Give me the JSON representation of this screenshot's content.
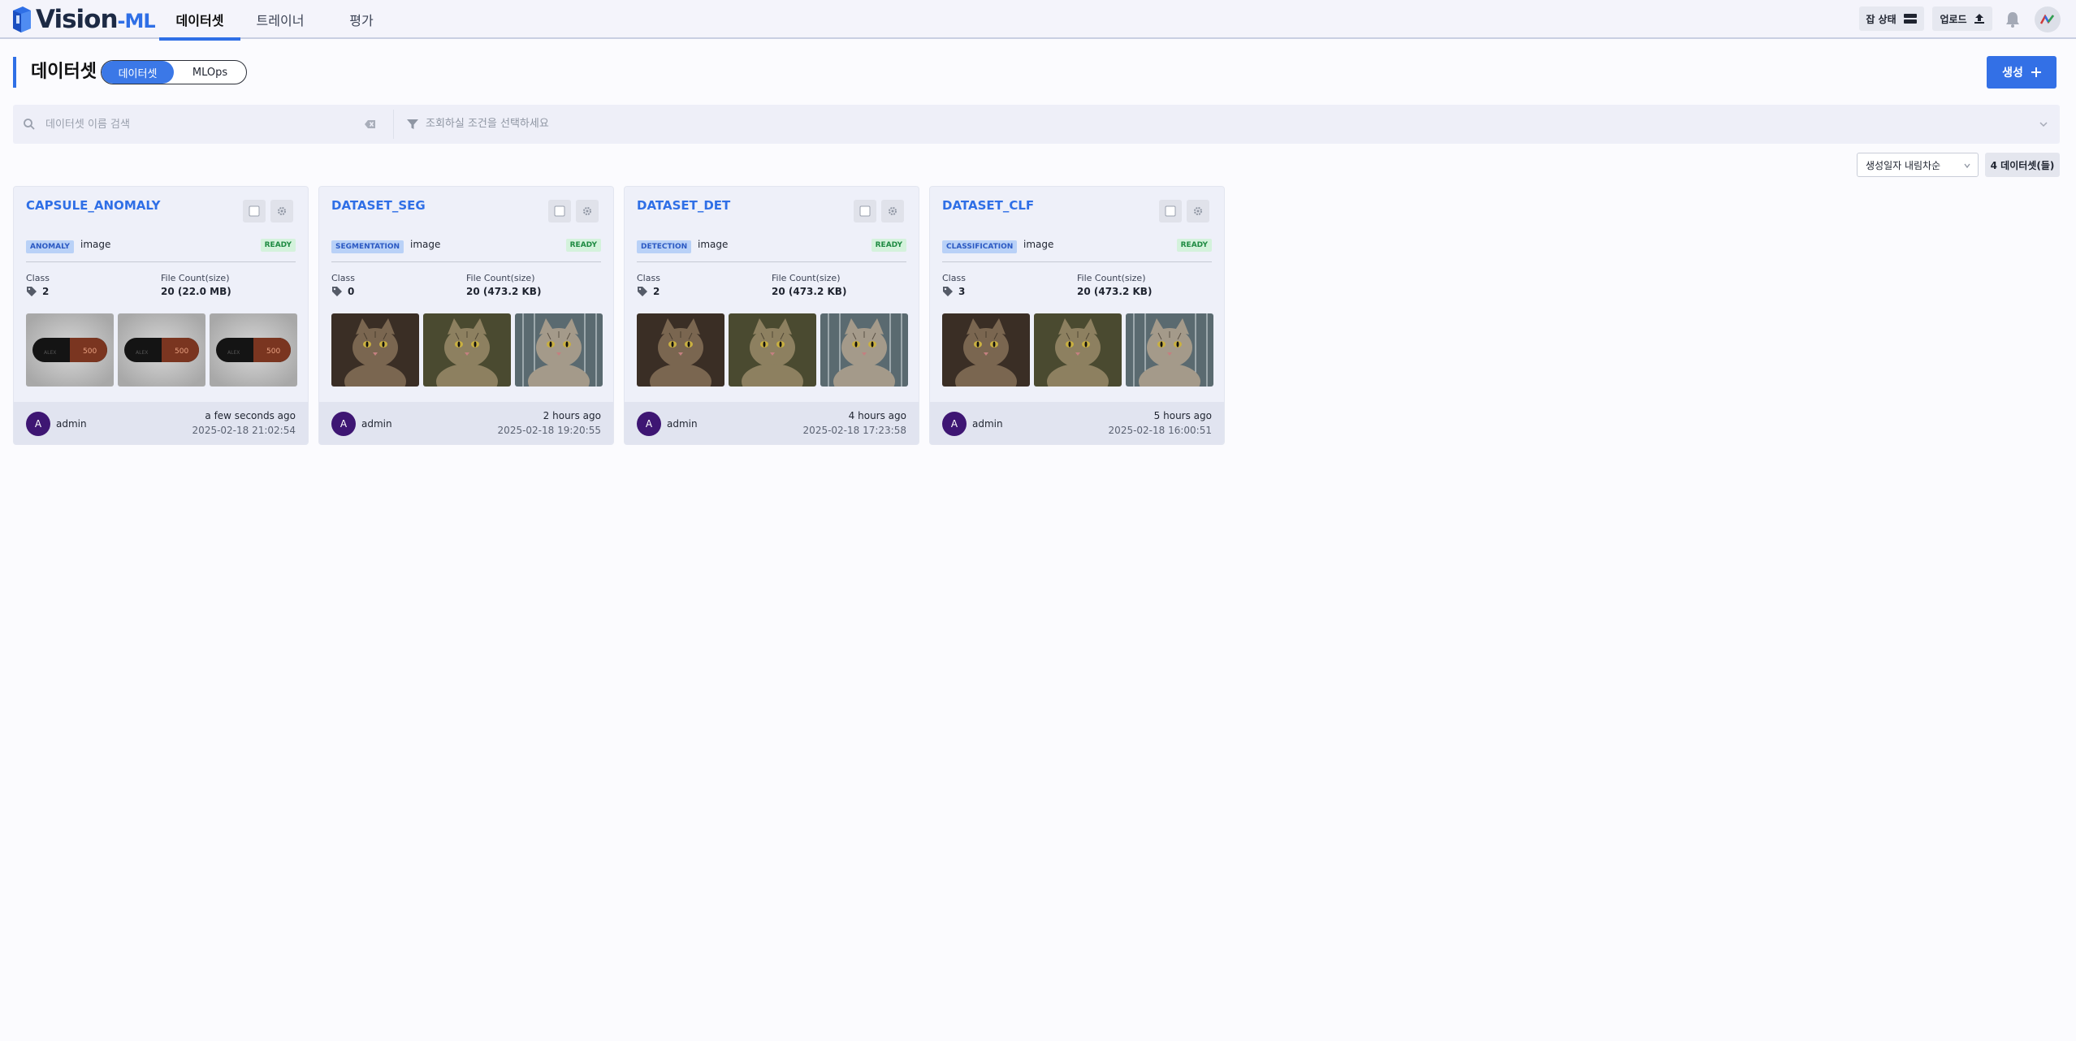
{
  "brand": {
    "name": "Vision",
    "suffix": "-ML"
  },
  "nav": {
    "tabs": [
      {
        "label": "데이터셋",
        "active": true
      },
      {
        "label": "트레이너",
        "active": false
      },
      {
        "label": "평가",
        "active": false
      }
    ]
  },
  "header_actions": {
    "job_status_label": "잡 상태",
    "upload_label": "업로드"
  },
  "page": {
    "title": "데이터셋",
    "segments": [
      {
        "label": "데이터셋",
        "active": true
      },
      {
        "label": "MLOps",
        "active": false
      }
    ],
    "create_label": "생성"
  },
  "search": {
    "placeholder": "데이터셋 이름 검색"
  },
  "filter": {
    "placeholder": "조회하실 조건을 선택하세요"
  },
  "sort": {
    "selected": "생성일자 내림차순"
  },
  "count_label": "4 데이터셋(들)",
  "colors": {
    "accent": "#2f6fe6",
    "ready": "#1e8a42",
    "avatar": "#3e1673"
  },
  "cards": [
    {
      "title": "CAPSULE_ANOMALY",
      "task": "ANOMALY",
      "modality": "image",
      "status": "READY",
      "class_label": "Class",
      "class_count": "2",
      "file_label": "File Count(size)",
      "file_value": "20 (22.0 MB)",
      "thumbs": "capsule",
      "user_initial": "A",
      "user": "admin",
      "relative_time": "a few seconds ago",
      "timestamp": "2025-02-18 21:02:54"
    },
    {
      "title": "DATASET_SEG",
      "task": "SEGMENTATION",
      "modality": "image",
      "status": "READY",
      "class_label": "Class",
      "class_count": "0",
      "file_label": "File Count(size)",
      "file_value": "20 (473.2 KB)",
      "thumbs": "cat",
      "user_initial": "A",
      "user": "admin",
      "relative_time": "2 hours ago",
      "timestamp": "2025-02-18 19:20:55"
    },
    {
      "title": "DATASET_DET",
      "task": "DETECTION",
      "modality": "image",
      "status": "READY",
      "class_label": "Class",
      "class_count": "2",
      "file_label": "File Count(size)",
      "file_value": "20 (473.2 KB)",
      "thumbs": "cat",
      "user_initial": "A",
      "user": "admin",
      "relative_time": "4 hours ago",
      "timestamp": "2025-02-18 17:23:58"
    },
    {
      "title": "DATASET_CLF",
      "task": "CLASSIFICATION",
      "modality": "image",
      "status": "READY",
      "class_label": "Class",
      "class_count": "3",
      "file_label": "File Count(size)",
      "file_value": "20 (473.2 KB)",
      "thumbs": "cat",
      "user_initial": "A",
      "user": "admin",
      "relative_time": "5 hours ago",
      "timestamp": "2025-02-18 16:00:51"
    }
  ]
}
